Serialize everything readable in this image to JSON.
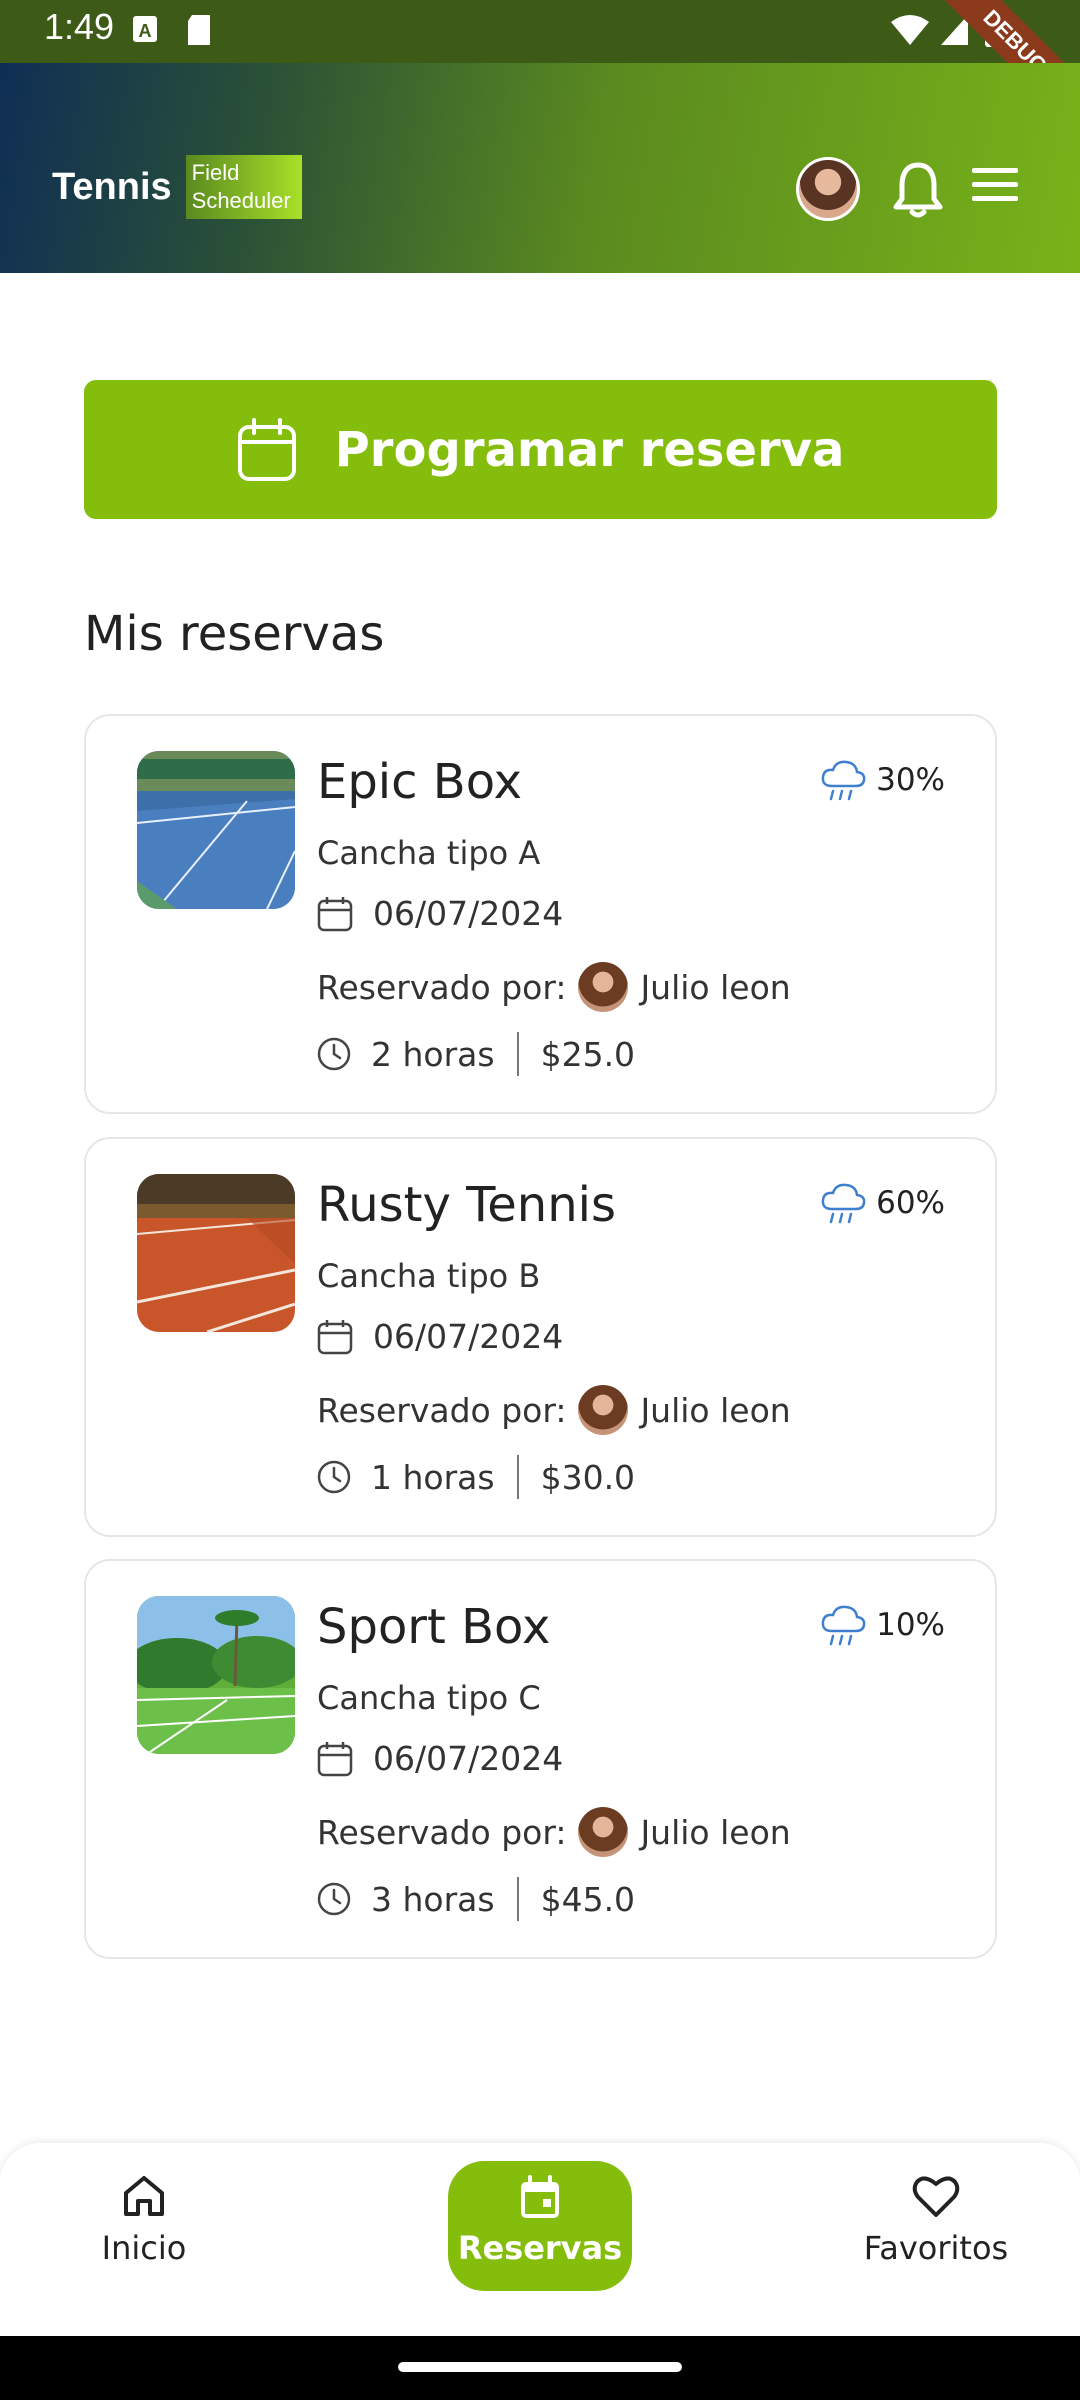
{
  "status_bar": {
    "time": "1:49"
  },
  "debug_ribbon": "DEBUG",
  "header": {
    "brand": "Tennis",
    "tag_line1": "Field",
    "tag_line2": "Scheduler"
  },
  "schedule_button": {
    "label": "Programar reserva"
  },
  "section_title": "Mis reservas",
  "reservations": [
    {
      "name": "Epic Box",
      "court_type": "Cancha tipo A",
      "date": "06/07/2024",
      "reserved_by_label": "Reservado por:",
      "reserved_by": "Julio leon",
      "duration": "2 horas",
      "price": "$25.0",
      "rain_chance": "30%",
      "thumb": "blue-hard-court"
    },
    {
      "name": "Rusty Tennis",
      "court_type": "Cancha tipo B",
      "date": "06/07/2024",
      "reserved_by_label": "Reservado por:",
      "reserved_by": "Julio leon",
      "duration": "1 horas",
      "price": "$30.0",
      "rain_chance": "60%",
      "thumb": "clay-court"
    },
    {
      "name": "Sport Box",
      "court_type": "Cancha tipo C",
      "date": "06/07/2024",
      "reserved_by_label": "Reservado por:",
      "reserved_by": "Julio leon",
      "duration": "3 horas",
      "price": "$45.0",
      "rain_chance": "10%",
      "thumb": "grass-court"
    }
  ],
  "bottom_nav": {
    "items": [
      {
        "label": "Inicio",
        "icon": "home-icon"
      },
      {
        "label": "Reservas",
        "icon": "calendar-icon",
        "active": true
      },
      {
        "label": "Favoritos",
        "icon": "heart-icon"
      }
    ]
  },
  "colors": {
    "accent": "#84bd0c",
    "header_start": "#0f2e55",
    "header_end": "#78b319",
    "rain_icon": "#3f7fd0"
  }
}
